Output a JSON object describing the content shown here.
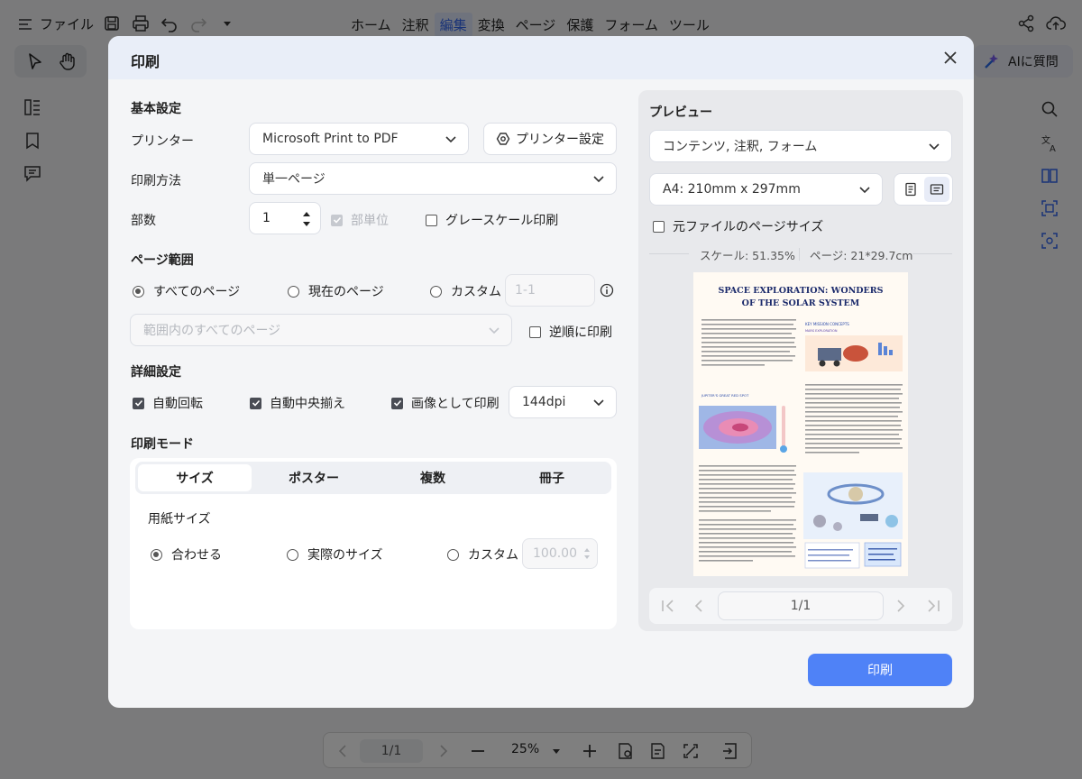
{
  "app": {
    "file_menu": "ファイル",
    "menu_tabs": [
      "ホーム",
      "注釈",
      "編集",
      "変換",
      "ページ",
      "保護",
      "フォーム",
      "ツール"
    ],
    "active_tab": "編集",
    "ai_button": "AIに質問",
    "bottom": {
      "page": "1/1",
      "zoom": "25%"
    }
  },
  "dialog": {
    "title": "印刷",
    "basic": {
      "section": "基本設定",
      "printer_label": "プリンター",
      "printer_value": "Microsoft Print to PDF",
      "printer_settings": "プリンター設定",
      "method_label": "印刷方法",
      "method_value": "単一ページ",
      "copies_label": "部数",
      "copies_value": "1",
      "collate": "部単位",
      "grayscale": "グレースケール印刷"
    },
    "range": {
      "section": "ページ範囲",
      "all": "すべてのページ",
      "current": "現在のページ",
      "custom": "カスタム",
      "custom_placeholder": "1-1",
      "subset": "範囲内のすべてのページ",
      "reverse": "逆順に印刷"
    },
    "advanced": {
      "section": "詳細設定",
      "auto_rotate": "自動回転",
      "auto_center": "自動中央揃え",
      "print_as_image": "画像として印刷",
      "dpi": "144dpi"
    },
    "mode": {
      "section": "印刷モード",
      "tabs": [
        "サイズ",
        "ポスター",
        "複数",
        "冊子"
      ],
      "active": "サイズ",
      "paper_label": "用紙サイズ",
      "fit": "合わせる",
      "actual": "実際のサイズ",
      "custom": "カスタム",
      "custom_value": "100.00"
    },
    "preview": {
      "title": "プレビュー",
      "content": "コンテンツ, 注釈, フォーム",
      "paper": "A4: 210mm x 297mm",
      "original_size": "元ファイルのページサイズ",
      "scale": "スケール: 51.35%",
      "page_size": "ページ: 21*29.7cm",
      "page_indicator": "1/1",
      "doc_title_1": "SPACE EXPLORATION: WONDERS",
      "doc_title_2": "OF THE SOLAR SYSTEM"
    },
    "print_button": "印刷"
  }
}
